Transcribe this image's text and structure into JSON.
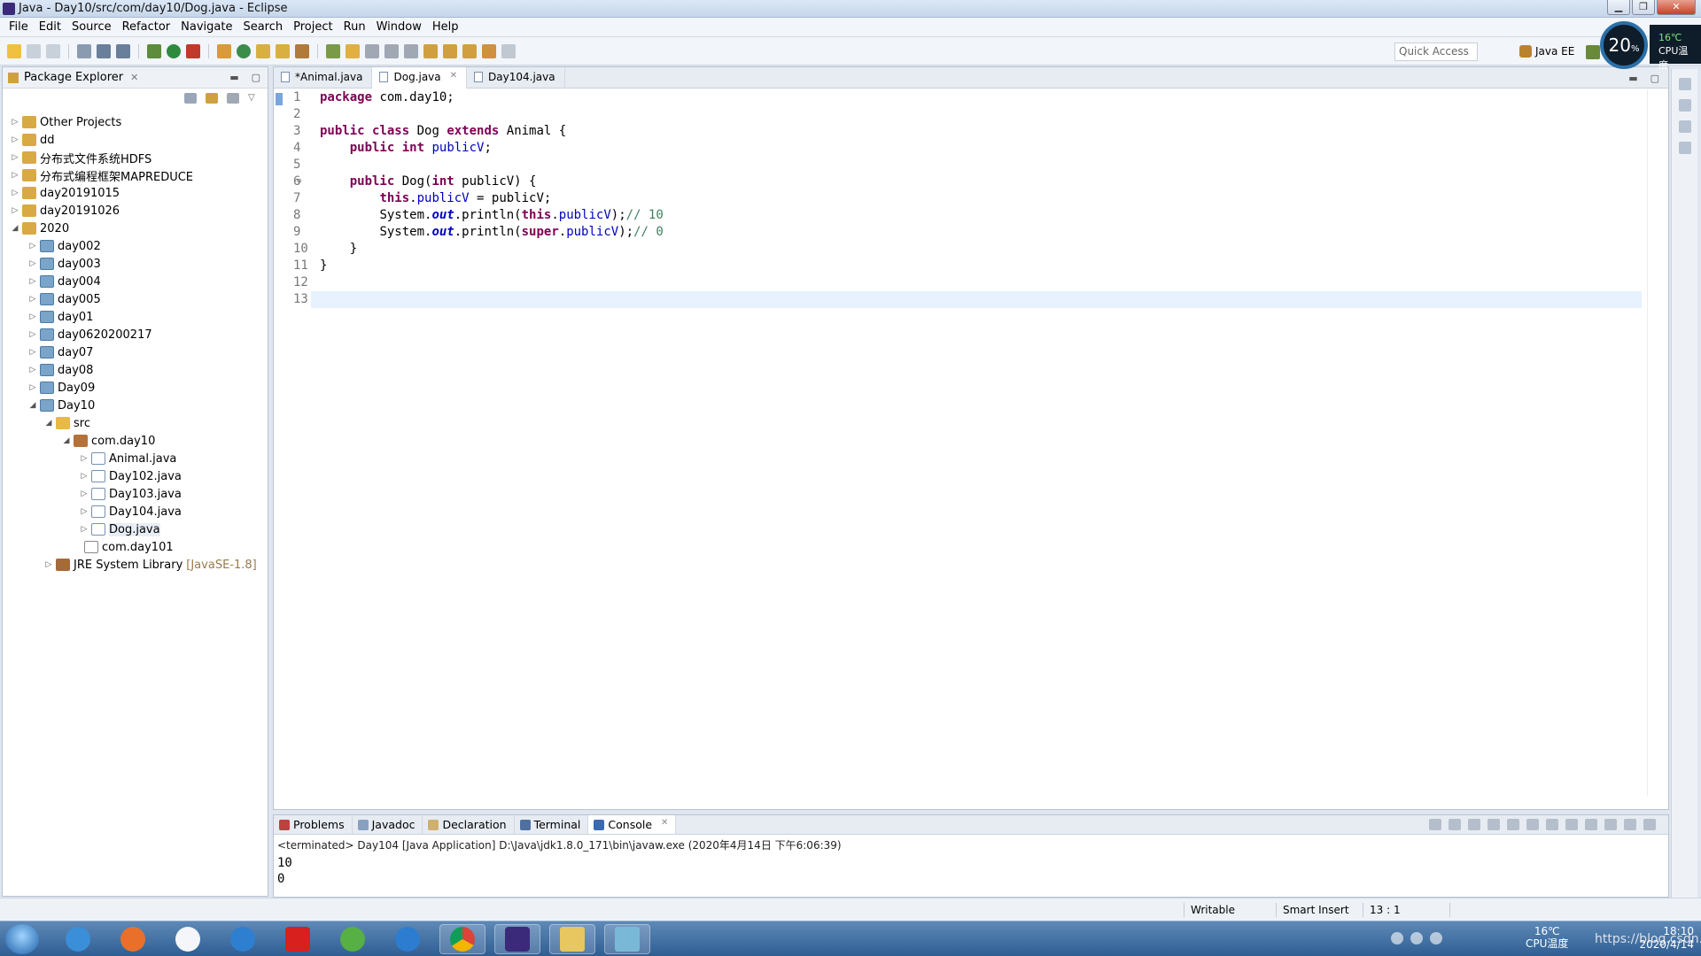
{
  "window": {
    "title": "Java - Day10/src/com/day10/Dog.java - Eclipse",
    "buttons": [
      "▁",
      "❐",
      "✕"
    ]
  },
  "menu": [
    "File",
    "Edit",
    "Source",
    "Refactor",
    "Navigate",
    "Search",
    "Project",
    "Run",
    "Window",
    "Help"
  ],
  "toolbar": {
    "quick_access": "Quick Access",
    "perspective": "Java EE"
  },
  "cpu": {
    "percent": "20",
    "percent_unit": "%",
    "temp": "16℃",
    "label": "CPU温度"
  },
  "package_explorer": {
    "title": "Package Explorer",
    "nodes": [
      {
        "label": "Other Projects"
      },
      {
        "label": "dd"
      },
      {
        "label": "分布式文件系统HDFS"
      },
      {
        "label": "分布式编程框架MAPREDUCE"
      },
      {
        "label": "day20191015"
      },
      {
        "label": "day20191026"
      },
      {
        "label": "2020"
      },
      {
        "label": "day002"
      },
      {
        "label": "day003"
      },
      {
        "label": "day004"
      },
      {
        "label": "day005"
      },
      {
        "label": "day01"
      },
      {
        "label": "day0620200217"
      },
      {
        "label": "day07"
      },
      {
        "label": "day08"
      },
      {
        "label": "Day09"
      },
      {
        "label": "Day10"
      },
      {
        "label": "src"
      },
      {
        "label": "com.day10"
      },
      {
        "label": "Animal.java"
      },
      {
        "label": "Day102.java"
      },
      {
        "label": "Day103.java"
      },
      {
        "label": "Day104.java"
      },
      {
        "label": "Dog.java"
      },
      {
        "label": "com.day101"
      },
      {
        "label": "JRE System Library",
        "suffix": "[JavaSE-1.8]"
      }
    ]
  },
  "editor": {
    "tabs": [
      {
        "label": "*Animal.java"
      },
      {
        "label": "Dog.java"
      },
      {
        "label": "Day104.java"
      }
    ],
    "line_numbers": [
      "1",
      "2",
      "3",
      "4",
      "5",
      "6",
      "7",
      "8",
      "9",
      "10",
      "11",
      "12",
      "13"
    ],
    "code": {
      "l1_kw": "package",
      "l1_rest": " com.day10;",
      "l3_kw1": "public",
      "l3_kw2": "class",
      "l3_name": " Dog ",
      "l3_kw3": "extends",
      "l3_rest": " Animal {",
      "l4_kw1": "public",
      "l4_kw2": "int",
      "l4_field": "publicV",
      "l4_rest": ";",
      "l6_kw1": "public",
      "l6_name": " Dog(",
      "l6_kw2": "int",
      "l6_rest": " publicV) {",
      "l7_kw": "this",
      "l7_dot": ".",
      "l7_field": "publicV",
      "l7_rest": " = publicV;",
      "l8_a": "System.",
      "l8_static": "out",
      "l8_b": ".println(",
      "l8_kw": "this",
      "l8_dot": ".",
      "l8_field": "publicV",
      "l8_c": ");",
      "l8_comment": "// 10",
      "l9_a": "System.",
      "l9_static": "out",
      "l9_b": ".println(",
      "l9_kw": "super",
      "l9_dot": ".",
      "l9_field": "publicV",
      "l9_c": ");",
      "l9_comment": "// 0",
      "l10": "}",
      "l11": "}"
    }
  },
  "console": {
    "tabs": [
      {
        "label": "Problems"
      },
      {
        "label": "Javadoc"
      },
      {
        "label": "Declaration"
      },
      {
        "label": "Terminal"
      },
      {
        "label": "Console"
      }
    ],
    "terminated": "<terminated> Day104 [Java Application] D:\\Java\\jdk1.8.0_171\\bin\\javaw.exe (2020年4月14日 下午6:06:39)",
    "output": [
      "10",
      "0"
    ]
  },
  "status": {
    "writable": "Writable",
    "insert_mode": "Smart Insert",
    "position": "13 : 1"
  },
  "taskbar": {
    "weather": "16℃",
    "weather_label": "CPU温度",
    "time": "18:10",
    "date": "2020/4/14",
    "watermark": "https://blog.csdn.net/gologo"
  },
  "colors": {
    "keyword": "#7f0055",
    "field": "#0000c0",
    "comment": "#3f7f5f",
    "current_line": "#e8f2fe"
  }
}
